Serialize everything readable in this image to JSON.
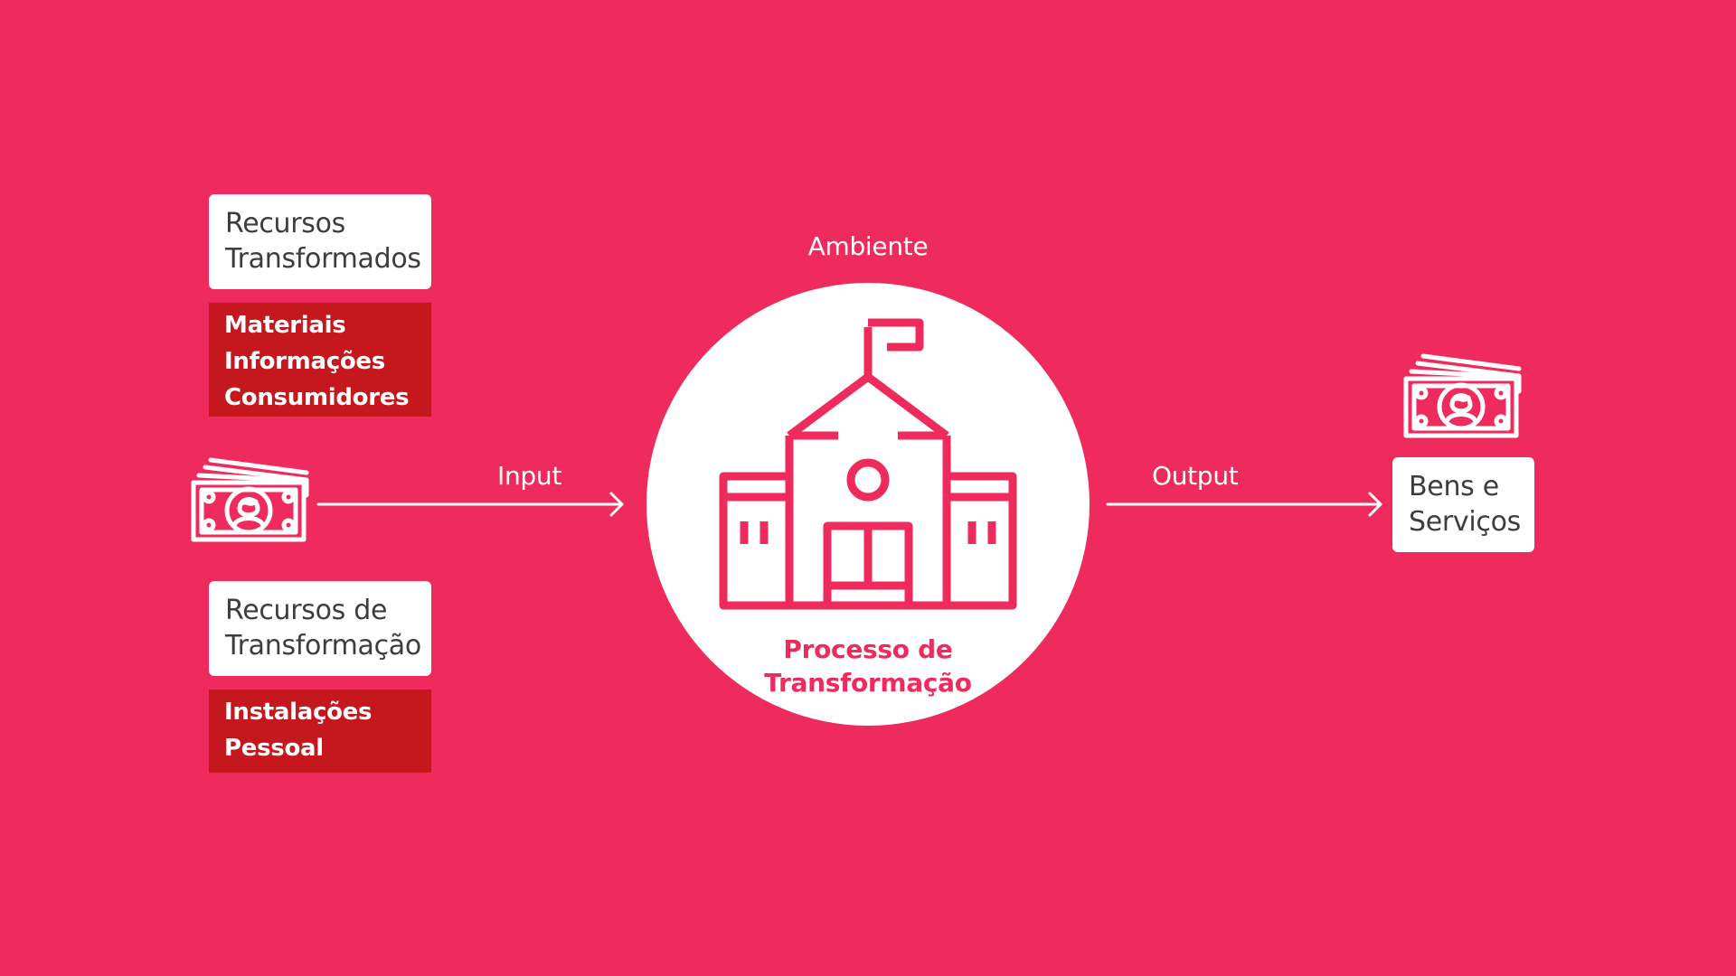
{
  "environment_label": "Ambiente",
  "input_label": "Input",
  "output_label": "Output",
  "transformed_resources": {
    "title_lines": [
      "Recursos",
      "Transformados"
    ],
    "items": [
      "Materiais",
      "Informações",
      "Consumidores"
    ]
  },
  "transforming_resources": {
    "title_lines": [
      "Recursos de",
      "Transformação"
    ],
    "items": [
      "Instalações",
      "Pessoal"
    ]
  },
  "process": {
    "label_lines": [
      "Processo de",
      "Transformação"
    ],
    "icon": "school-building-icon"
  },
  "output_box": {
    "lines": [
      "Bens e",
      "Serviços"
    ]
  },
  "icons": {
    "input": "money-bills-icon",
    "output": "money-bills-icon"
  },
  "colors": {
    "background": "#ef2a5d",
    "dark_red": "#c4171e",
    "white": "#ffffff",
    "text_dark": "#3d3d3d"
  }
}
